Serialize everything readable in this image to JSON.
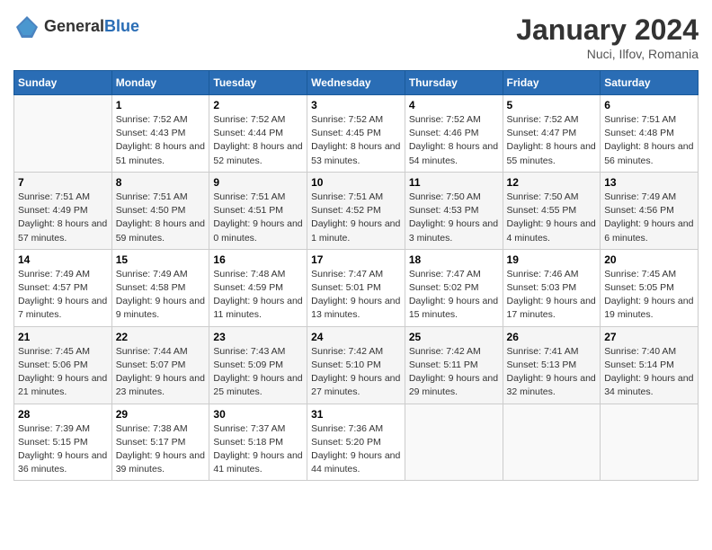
{
  "logo": {
    "general": "General",
    "blue": "Blue"
  },
  "title": {
    "month": "January 2024",
    "location": "Nuci, Ilfov, Romania"
  },
  "headers": [
    "Sunday",
    "Monday",
    "Tuesday",
    "Wednesday",
    "Thursday",
    "Friday",
    "Saturday"
  ],
  "weeks": [
    [
      {
        "num": "",
        "sunrise": "",
        "sunset": "",
        "daylight": ""
      },
      {
        "num": "1",
        "sunrise": "Sunrise: 7:52 AM",
        "sunset": "Sunset: 4:43 PM",
        "daylight": "Daylight: 8 hours and 51 minutes."
      },
      {
        "num": "2",
        "sunrise": "Sunrise: 7:52 AM",
        "sunset": "Sunset: 4:44 PM",
        "daylight": "Daylight: 8 hours and 52 minutes."
      },
      {
        "num": "3",
        "sunrise": "Sunrise: 7:52 AM",
        "sunset": "Sunset: 4:45 PM",
        "daylight": "Daylight: 8 hours and 53 minutes."
      },
      {
        "num": "4",
        "sunrise": "Sunrise: 7:52 AM",
        "sunset": "Sunset: 4:46 PM",
        "daylight": "Daylight: 8 hours and 54 minutes."
      },
      {
        "num": "5",
        "sunrise": "Sunrise: 7:52 AM",
        "sunset": "Sunset: 4:47 PM",
        "daylight": "Daylight: 8 hours and 55 minutes."
      },
      {
        "num": "6",
        "sunrise": "Sunrise: 7:51 AM",
        "sunset": "Sunset: 4:48 PM",
        "daylight": "Daylight: 8 hours and 56 minutes."
      }
    ],
    [
      {
        "num": "7",
        "sunrise": "Sunrise: 7:51 AM",
        "sunset": "Sunset: 4:49 PM",
        "daylight": "Daylight: 8 hours and 57 minutes."
      },
      {
        "num": "8",
        "sunrise": "Sunrise: 7:51 AM",
        "sunset": "Sunset: 4:50 PM",
        "daylight": "Daylight: 8 hours and 59 minutes."
      },
      {
        "num": "9",
        "sunrise": "Sunrise: 7:51 AM",
        "sunset": "Sunset: 4:51 PM",
        "daylight": "Daylight: 9 hours and 0 minutes."
      },
      {
        "num": "10",
        "sunrise": "Sunrise: 7:51 AM",
        "sunset": "Sunset: 4:52 PM",
        "daylight": "Daylight: 9 hours and 1 minute."
      },
      {
        "num": "11",
        "sunrise": "Sunrise: 7:50 AM",
        "sunset": "Sunset: 4:53 PM",
        "daylight": "Daylight: 9 hours and 3 minutes."
      },
      {
        "num": "12",
        "sunrise": "Sunrise: 7:50 AM",
        "sunset": "Sunset: 4:55 PM",
        "daylight": "Daylight: 9 hours and 4 minutes."
      },
      {
        "num": "13",
        "sunrise": "Sunrise: 7:49 AM",
        "sunset": "Sunset: 4:56 PM",
        "daylight": "Daylight: 9 hours and 6 minutes."
      }
    ],
    [
      {
        "num": "14",
        "sunrise": "Sunrise: 7:49 AM",
        "sunset": "Sunset: 4:57 PM",
        "daylight": "Daylight: 9 hours and 7 minutes."
      },
      {
        "num": "15",
        "sunrise": "Sunrise: 7:49 AM",
        "sunset": "Sunset: 4:58 PM",
        "daylight": "Daylight: 9 hours and 9 minutes."
      },
      {
        "num": "16",
        "sunrise": "Sunrise: 7:48 AM",
        "sunset": "Sunset: 4:59 PM",
        "daylight": "Daylight: 9 hours and 11 minutes."
      },
      {
        "num": "17",
        "sunrise": "Sunrise: 7:47 AM",
        "sunset": "Sunset: 5:01 PM",
        "daylight": "Daylight: 9 hours and 13 minutes."
      },
      {
        "num": "18",
        "sunrise": "Sunrise: 7:47 AM",
        "sunset": "Sunset: 5:02 PM",
        "daylight": "Daylight: 9 hours and 15 minutes."
      },
      {
        "num": "19",
        "sunrise": "Sunrise: 7:46 AM",
        "sunset": "Sunset: 5:03 PM",
        "daylight": "Daylight: 9 hours and 17 minutes."
      },
      {
        "num": "20",
        "sunrise": "Sunrise: 7:45 AM",
        "sunset": "Sunset: 5:05 PM",
        "daylight": "Daylight: 9 hours and 19 minutes."
      }
    ],
    [
      {
        "num": "21",
        "sunrise": "Sunrise: 7:45 AM",
        "sunset": "Sunset: 5:06 PM",
        "daylight": "Daylight: 9 hours and 21 minutes."
      },
      {
        "num": "22",
        "sunrise": "Sunrise: 7:44 AM",
        "sunset": "Sunset: 5:07 PM",
        "daylight": "Daylight: 9 hours and 23 minutes."
      },
      {
        "num": "23",
        "sunrise": "Sunrise: 7:43 AM",
        "sunset": "Sunset: 5:09 PM",
        "daylight": "Daylight: 9 hours and 25 minutes."
      },
      {
        "num": "24",
        "sunrise": "Sunrise: 7:42 AM",
        "sunset": "Sunset: 5:10 PM",
        "daylight": "Daylight: 9 hours and 27 minutes."
      },
      {
        "num": "25",
        "sunrise": "Sunrise: 7:42 AM",
        "sunset": "Sunset: 5:11 PM",
        "daylight": "Daylight: 9 hours and 29 minutes."
      },
      {
        "num": "26",
        "sunrise": "Sunrise: 7:41 AM",
        "sunset": "Sunset: 5:13 PM",
        "daylight": "Daylight: 9 hours and 32 minutes."
      },
      {
        "num": "27",
        "sunrise": "Sunrise: 7:40 AM",
        "sunset": "Sunset: 5:14 PM",
        "daylight": "Daylight: 9 hours and 34 minutes."
      }
    ],
    [
      {
        "num": "28",
        "sunrise": "Sunrise: 7:39 AM",
        "sunset": "Sunset: 5:15 PM",
        "daylight": "Daylight: 9 hours and 36 minutes."
      },
      {
        "num": "29",
        "sunrise": "Sunrise: 7:38 AM",
        "sunset": "Sunset: 5:17 PM",
        "daylight": "Daylight: 9 hours and 39 minutes."
      },
      {
        "num": "30",
        "sunrise": "Sunrise: 7:37 AM",
        "sunset": "Sunset: 5:18 PM",
        "daylight": "Daylight: 9 hours and 41 minutes."
      },
      {
        "num": "31",
        "sunrise": "Sunrise: 7:36 AM",
        "sunset": "Sunset: 5:20 PM",
        "daylight": "Daylight: 9 hours and 44 minutes."
      },
      {
        "num": "",
        "sunrise": "",
        "sunset": "",
        "daylight": ""
      },
      {
        "num": "",
        "sunrise": "",
        "sunset": "",
        "daylight": ""
      },
      {
        "num": "",
        "sunrise": "",
        "sunset": "",
        "daylight": ""
      }
    ]
  ]
}
